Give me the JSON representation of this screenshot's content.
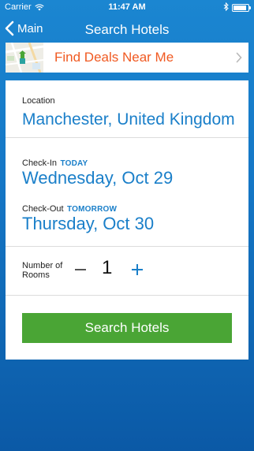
{
  "status_bar": {
    "carrier": "Carrier",
    "time": "11:47 AM",
    "battery_level": 0.9,
    "wifi_icon": "wifi-icon",
    "bluetooth_icon": "bluetooth-icon"
  },
  "nav": {
    "back_label": "Main",
    "title": "Search Hotels"
  },
  "deals": {
    "label": "Find Deals Near Me",
    "label_color": "#f05a22"
  },
  "form": {
    "location_label": "Location",
    "location_value": "Manchester, United Kingdom",
    "checkin_label": "Check-In",
    "checkin_tag": "TODAY",
    "checkin_value": "Wednesday, Oct 29",
    "checkout_label": "Check-Out",
    "checkout_tag": "TOMORROW",
    "checkout_value": "Thursday, Oct 30",
    "rooms_label": "Number of Rooms",
    "rooms_count": "1",
    "search_button": "Search Hotels"
  },
  "colors": {
    "accent_blue": "#1a7fc9",
    "button_green": "#4aa535",
    "background_blue": "#1577c6"
  }
}
